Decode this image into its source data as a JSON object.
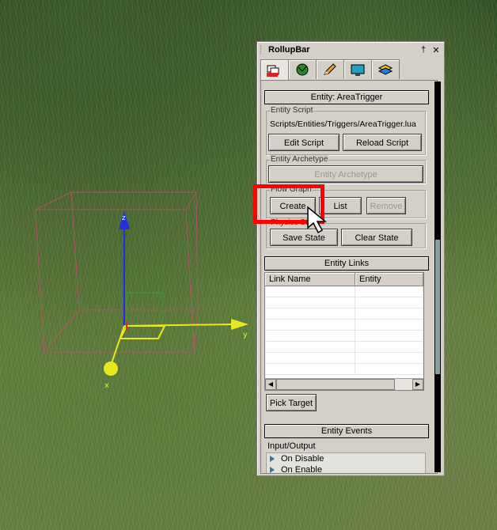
{
  "rollup": {
    "title": "RollupBar",
    "pin_glyph": "†",
    "close_glyph": "✕",
    "tabs": [
      {
        "icon": "objects-icon"
      },
      {
        "icon": "terrain-icon"
      },
      {
        "icon": "pencil-icon"
      },
      {
        "icon": "display-icon"
      },
      {
        "icon": "layers-icon"
      }
    ],
    "entity_header": "Entity: AreaTrigger",
    "entity_script": {
      "label": "Entity Script",
      "path": "Scripts/Entities/Triggers/AreaTrigger.lua",
      "edit_button": "Edit Script",
      "reload_button": "Reload Script"
    },
    "entity_archetype": {
      "label": "Entity Archetype",
      "button": "Entity Archetype"
    },
    "flow_graph": {
      "label": "Flow Graph",
      "create_button": "Create",
      "list_button": "List",
      "remove_button": "Remove"
    },
    "physics_state": {
      "label": "Physics State",
      "save_button": "Save State",
      "clear_button": "Clear State"
    },
    "entity_links": {
      "header": "Entity Links",
      "columns": [
        "Link Name",
        "Entity"
      ],
      "rows": 8,
      "pick_button": "Pick Target"
    },
    "entity_events": {
      "header": "Entity Events",
      "io_label": "Input/Output",
      "items": [
        "On Disable",
        "On Enable"
      ]
    }
  },
  "gizmo": {
    "axis_labels": {
      "z": "z",
      "y": "y",
      "x": "x"
    }
  }
}
